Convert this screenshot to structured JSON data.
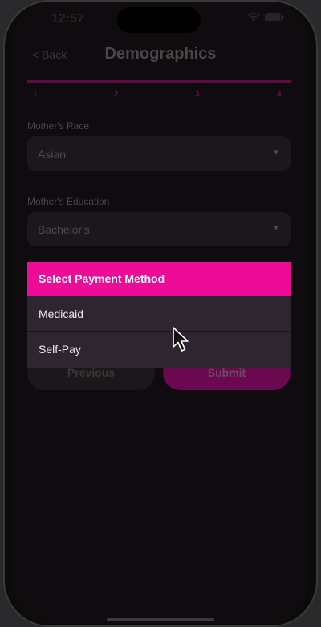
{
  "status": {
    "time": "12:57"
  },
  "nav": {
    "back_label": "< Back",
    "title": "Demographics"
  },
  "progress": {
    "steps": [
      "1",
      "2",
      "3",
      "4"
    ],
    "fraction": 1.0
  },
  "fields": {
    "race": {
      "label": "Mother's Race",
      "value": "Asian"
    },
    "education": {
      "label": "Mother's Education",
      "value": "Bachelor's"
    }
  },
  "picker": {
    "title": "Select Payment Method",
    "options": [
      "Medicaid",
      "Self-Pay"
    ]
  },
  "buttons": {
    "previous_label": "Previous",
    "submit_label": "Submit"
  },
  "icons": {
    "caret": "chevron-down-icon",
    "wifi": "wifi-icon",
    "battery": "battery-icon",
    "cursor": "mouse-pointer-icon"
  },
  "colors": {
    "accent": "#ec0c97",
    "accent_dim": "#6a0850",
    "background": "#0f0b0e",
    "picker_bg": "#2f2530"
  }
}
